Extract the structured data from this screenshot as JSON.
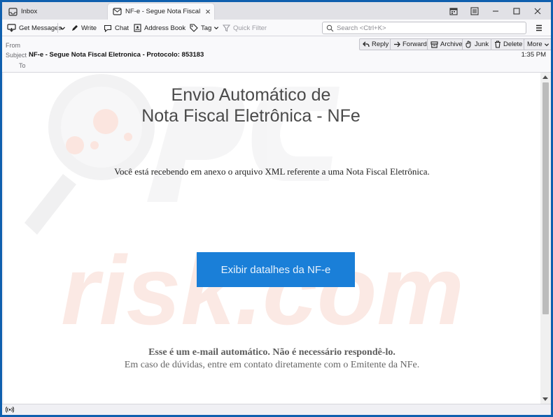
{
  "tabs": [
    {
      "label": "Inbox",
      "icon": "inbox-icon"
    },
    {
      "label": "NF-e - Segue Nota Fiscal Ele",
      "icon": "mail-icon",
      "active": true
    }
  ],
  "toolbar": {
    "get_messages": "Get Messages",
    "write": "Write",
    "chat": "Chat",
    "address_book": "Address Book",
    "tag": "Tag",
    "quick_filter": "Quick Filter",
    "search_placeholder": "Search <Ctrl+K>"
  },
  "header": {
    "from_label": "From",
    "subject_label": "Subject",
    "to_label": "To",
    "subject": "NF-e - Segue Nota Fiscal Eletronica - Protocolo: 853183",
    "time": "1:35 PM"
  },
  "actions": {
    "reply": "Reply",
    "forward": "Forward",
    "archive": "Archive",
    "junk": "Junk",
    "delete": "Delete",
    "more": "More"
  },
  "message": {
    "title_line1": "Envio Automático de",
    "title_line2": "Nota Fiscal Eletrônica - NFe",
    "lead": "Você está recebendo em anexo o arquivo XML referente a uma Nota Fiscal Eletrônica.",
    "button": "Exibir datalhes da NF-e",
    "footer_bold": "Esse é um e-mail automático. Não é necessário respondê-lo.",
    "footer": "Em caso de dúvidas, entre em contato diretamente com o Emitente da NFe."
  },
  "watermark": {
    "text": "risk.com"
  },
  "colors": {
    "window_border": "#0f5fae",
    "cta_background": "#1a7fd8",
    "watermark": "#fbe9e4"
  }
}
